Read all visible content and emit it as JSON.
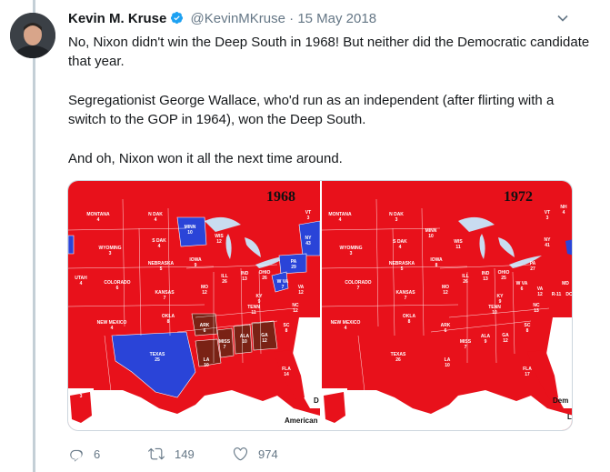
{
  "author": {
    "name": "Kevin M. Kruse",
    "handle": "@KevinMKruse",
    "date_sep": "·",
    "date": "15 May 2018",
    "verified_color": "#1da1f2"
  },
  "tweet": {
    "lines": [
      "No, Nixon didn't win the Deep South in 1968! But neither did the Democratic candidate that year.",
      "Segregationist George Wallace, who'd run as an independent (after flirting with a switch to the GOP in 1964), won the Deep South.",
      "And oh, Nixon won it all the next time around."
    ]
  },
  "maps": {
    "left": {
      "year": "1968",
      "legend": "American",
      "side_mark": "D",
      "colors": {
        "republican": "#e8111b",
        "democrat": "#2a44d8",
        "independent": "#7a2215",
        "water": "#ffffff"
      },
      "labels": [
        "MONTANA",
        "N DAK",
        "MINN",
        "WIS",
        "S DAK",
        "WYOMING",
        "IOWA",
        "NEBRASKA",
        "ILL",
        "IND",
        "OHIO",
        "PA",
        "NY",
        "UTAH",
        "COLORADO",
        "KANSAS",
        "MO",
        "KY",
        "W VA",
        "VA",
        "OKLA",
        "ARK",
        "TENN",
        "NC",
        "NEW MEXICO",
        "TEXAS",
        "LA",
        "MISS",
        "ALA",
        "GA",
        "SC",
        "FLA",
        "ALASKA",
        "VT"
      ],
      "values": [
        "4",
        "4",
        "10",
        "12",
        "4",
        "3",
        "9",
        "5",
        "26",
        "13",
        "26",
        "29",
        "43",
        "4",
        "6",
        "7",
        "12",
        "9",
        "7",
        "12",
        "8",
        "6",
        "11",
        "12",
        "4",
        "25",
        "10",
        "7",
        "10",
        "12",
        "8",
        "14",
        "3",
        "3"
      ]
    },
    "right": {
      "year": "1972",
      "legend": "Dem",
      "side_mark": "L",
      "colors": {
        "republican": "#e8111b",
        "democrat": "#2a44d8",
        "water": "#ffffff"
      },
      "labels": [
        "MONTANA",
        "N DAK",
        "MINN",
        "WIS",
        "S DAK",
        "WYOMING",
        "IOWA",
        "NEBRASKA",
        "ILL",
        "IND",
        "OHIO",
        "PA",
        "NY",
        "COLORADO",
        "KANSAS",
        "MO",
        "KY",
        "W VA",
        "VA",
        "OKLA",
        "ARK",
        "TENN",
        "NC",
        "NEW MEXICO",
        "TEXAS",
        "LA",
        "MISS",
        "ALA",
        "GA",
        "SC",
        "FLA",
        "VT",
        "NH",
        "R-11",
        "MD",
        "DC"
      ],
      "values": [
        "4",
        "3",
        "10",
        "11",
        "4",
        "3",
        "8",
        "5",
        "26",
        "13",
        "25",
        "27",
        "41",
        "7",
        "7",
        "12",
        "9",
        "6",
        "12",
        "8",
        "6",
        "10",
        "13",
        "4",
        "26",
        "10",
        "7",
        "9",
        "12",
        "8",
        "17",
        "3",
        "4",
        "",
        "",
        ""
      ]
    }
  },
  "actions": {
    "reply_count": "6",
    "retweet_count": "149",
    "like_count": "974"
  }
}
